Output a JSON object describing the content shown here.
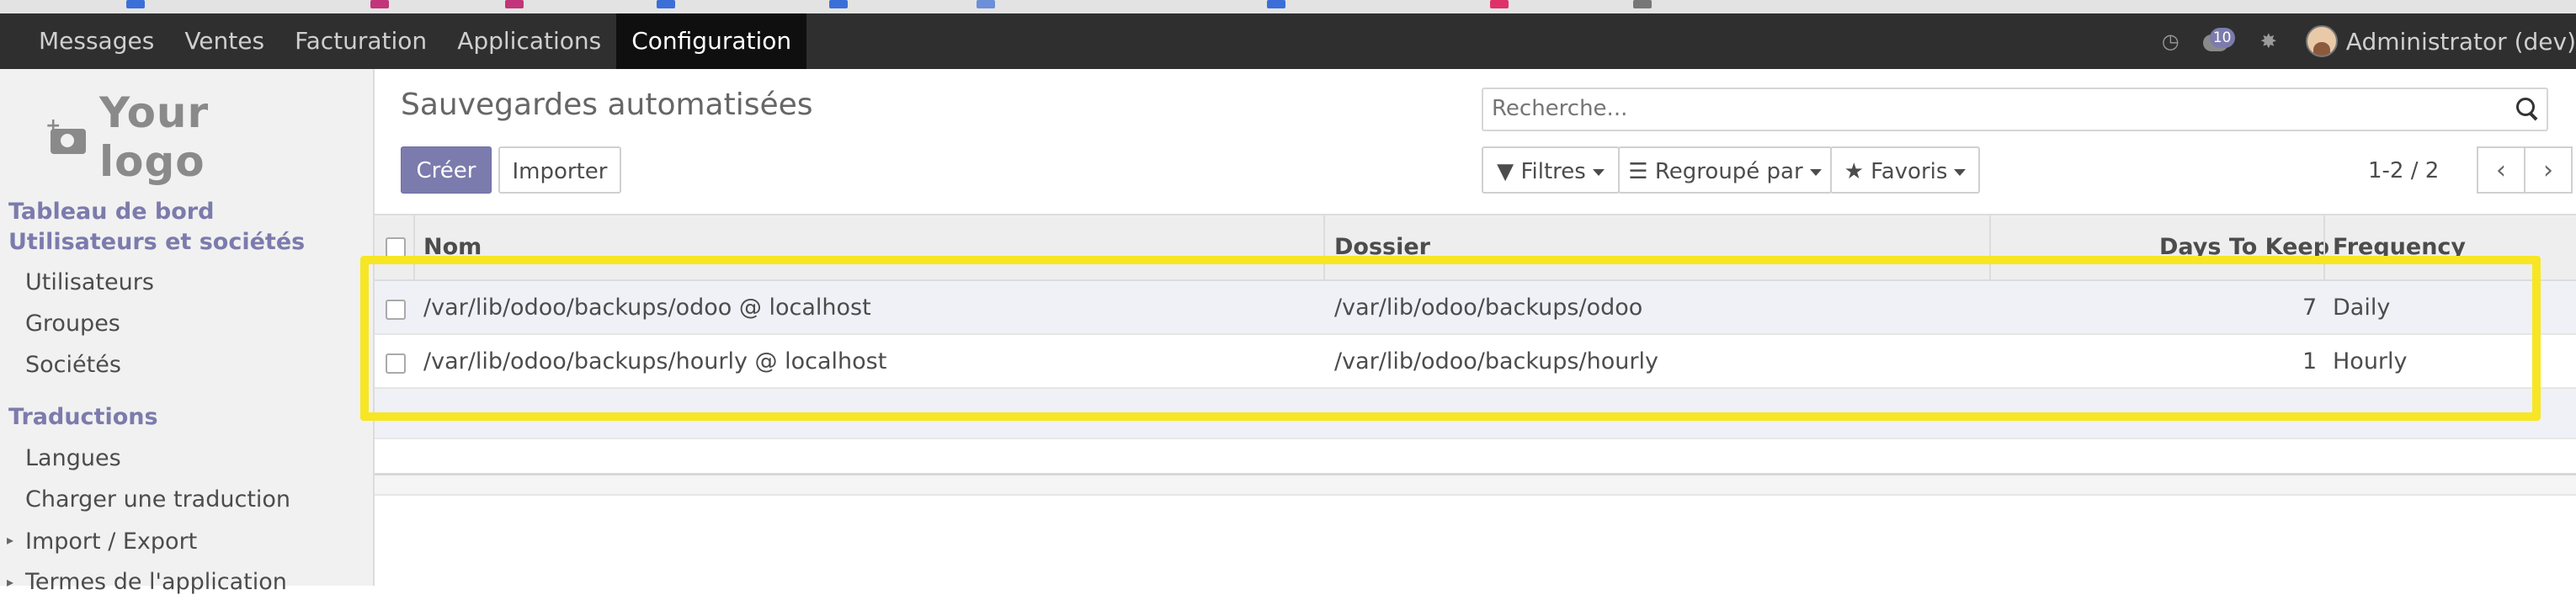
{
  "topbar": {
    "menu": [
      {
        "label": "Messages"
      },
      {
        "label": "Ventes"
      },
      {
        "label": "Facturation"
      },
      {
        "label": "Applications"
      },
      {
        "label": "Configuration"
      }
    ],
    "active_menu": "Configuration",
    "chat_count": "10",
    "user_name": "Administrator (dev)"
  },
  "sidebar": {
    "logo_text": "Your logo",
    "sections": [
      {
        "label": "Tableau de bord"
      },
      {
        "label": "Utilisateurs et sociétés"
      },
      {
        "label": "Traductions"
      }
    ],
    "users_items": [
      "Utilisateurs",
      "Groupes",
      "Sociétés"
    ],
    "translation_items": [
      "Langues",
      "Charger une traduction",
      "Import / Export",
      "Termes de l'application"
    ]
  },
  "control_panel": {
    "title": "Sauvegardes automatisées",
    "create_label": "Créer",
    "import_label": "Importer",
    "search_placeholder": "Recherche...",
    "filters_label": "Filtres",
    "group_by_label": "Regroupé par",
    "favorites_label": "Favoris",
    "pager": "1-2 / 2"
  },
  "list": {
    "columns": {
      "name": "Nom",
      "folder": "Dossier",
      "days_to_keep": "Days To Keep",
      "frequency": "Frequency"
    },
    "rows": [
      {
        "name": "/var/lib/odoo/backups/odoo @ localhost",
        "folder": "/var/lib/odoo/backups/odoo",
        "days_to_keep": "7",
        "frequency": "Daily"
      },
      {
        "name": "/var/lib/odoo/backups/hourly @ localhost",
        "folder": "/var/lib/odoo/backups/hourly",
        "days_to_keep": "1",
        "frequency": "Hourly"
      }
    ]
  },
  "colors": {
    "brand": "#7c7bad",
    "topbar": "#2f2f2f",
    "highlight": "#f7e624"
  }
}
